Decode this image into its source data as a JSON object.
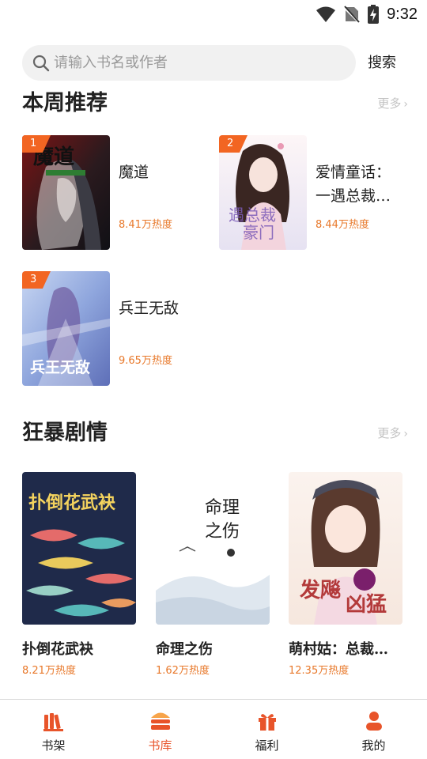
{
  "status_bar": {
    "time": "9:32",
    "icons": [
      "wifi-icon",
      "no-sim-icon",
      "battery-charging-icon"
    ]
  },
  "search": {
    "placeholder": "请输入书名或作者",
    "button_label": "搜索"
  },
  "weekly": {
    "title": "本周推荐",
    "more_label": "更多",
    "items": [
      {
        "rank": "1",
        "title": "魔道",
        "heat": "8.41万热度"
      },
      {
        "rank": "2",
        "title": "爱情童话：一遇总裁…",
        "heat": "8.44万热度"
      },
      {
        "rank": "3",
        "title": "兵王无敌",
        "heat": "9.65万热度"
      }
    ]
  },
  "plot": {
    "title": "狂暴剧情",
    "more_label": "更多",
    "items": [
      {
        "title": "扑倒花武袂",
        "heat": "8.21万热度"
      },
      {
        "title": "命理之伤",
        "heat": "1.62万热度"
      },
      {
        "title": "萌村姑：总裁…",
        "heat": "12.35万热度"
      }
    ]
  },
  "tabs": [
    {
      "label": "书架",
      "icon": "bookshelf-icon",
      "active": false
    },
    {
      "label": "书库",
      "icon": "library-icon",
      "active": true
    },
    {
      "label": "福利",
      "icon": "gift-icon",
      "active": false
    },
    {
      "label": "我的",
      "icon": "profile-icon",
      "active": false
    }
  ],
  "colors": {
    "accent": "#e8542a",
    "heat": "#e8782a",
    "badge": "#f26522"
  }
}
